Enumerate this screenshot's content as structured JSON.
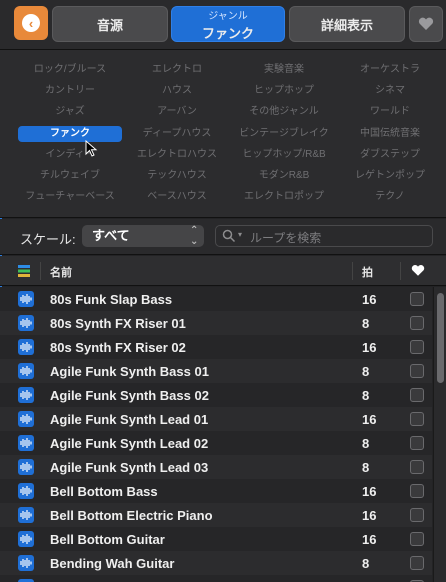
{
  "tabs": {
    "source": "音源",
    "genre_sub": "ジャンル",
    "genre": "ファンク",
    "details": "詳細表示"
  },
  "genres": [
    "ロック/ブルース",
    "エレクトロ",
    "実験音楽",
    "オーケストラ",
    "カントリー",
    "ハウス",
    "ヒップホップ",
    "シネマ",
    "ジャズ",
    "アーバン",
    "その他ジャンル",
    "ワールド",
    "ファンク",
    "ディープハウス",
    "ビンテージブレイク",
    "中国伝統音楽",
    "インディー",
    "エレクトロハウス",
    "ヒップホップ/R&B",
    "ダブステップ",
    "チルウェイブ",
    "テックハウス",
    "モダンR&B",
    "レゲトンポップ",
    "フューチャーベース",
    "ベースハウス",
    "エレクトロポップ",
    "テクノ"
  ],
  "selected_genre": "ファンク",
  "scale": {
    "label": "スケール:",
    "value": "すべて"
  },
  "search": {
    "placeholder": "ループを検索"
  },
  "table": {
    "col_name": "名前",
    "col_beats": "拍",
    "rows": [
      {
        "name": "80s Funk Slap Bass",
        "beats": "16"
      },
      {
        "name": "80s Synth FX Riser 01",
        "beats": "8"
      },
      {
        "name": "80s Synth FX Riser 02",
        "beats": "16"
      },
      {
        "name": "Agile Funk Synth Bass 01",
        "beats": "8"
      },
      {
        "name": "Agile Funk Synth Bass 02",
        "beats": "8"
      },
      {
        "name": "Agile Funk Synth Lead 01",
        "beats": "16"
      },
      {
        "name": "Agile Funk Synth Lead 02",
        "beats": "8"
      },
      {
        "name": "Agile Funk Synth Lead 03",
        "beats": "8"
      },
      {
        "name": "Bell Bottom Bass",
        "beats": "16"
      },
      {
        "name": "Bell Bottom Electric Piano",
        "beats": "16"
      },
      {
        "name": "Bell Bottom Guitar",
        "beats": "16"
      },
      {
        "name": "Bending Wah Guitar",
        "beats": "8"
      },
      {
        "name": "",
        "beats": ""
      }
    ]
  },
  "colors": {
    "accent": "#1f6fd6",
    "back_button": "#e8893a"
  }
}
